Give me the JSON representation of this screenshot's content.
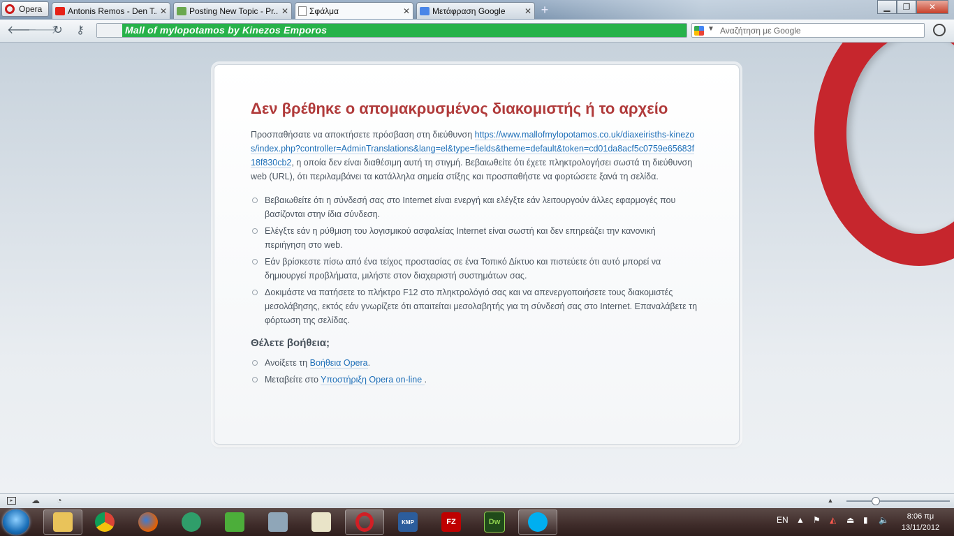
{
  "browser": {
    "menu_label": "Opera",
    "tabs": [
      {
        "title": "Antonis Remos - Den T...",
        "icon": "youtube-icon",
        "active": false
      },
      {
        "title": "Posting New Topic - Pr...",
        "icon": "forum-icon",
        "active": false
      },
      {
        "title": "Σφάλμα",
        "icon": "page-icon",
        "active": true
      },
      {
        "title": "Μετάφραση Google",
        "icon": "google-translate-icon",
        "active": false
      }
    ],
    "address": "Mall of mylopotamos by Kinezos Emporos",
    "search_placeholder": "Αναζήτηση με Google"
  },
  "error_page": {
    "title": "Δεν βρέθηκε ο απομακρυσμένος διακομιστής ή το αρχείο",
    "intro_before": "Προσπαθήσατε να αποκτήσετε πρόσβαση στη διεύθυνση ",
    "url": "https://www.mallofmylopotamos.co.uk/diaxeirisths-kinezos/index.php?controller=AdminTranslations&lang=el&type=fields&theme=default&token=cd01da8acf5c0759e65683f18f830cb2",
    "intro_after": ", η οποία δεν είναι διαθέσιμη αυτή τη στιγμή. Βεβαιωθείτε ότι έχετε πληκτρολογήσει σωστά τη διεύθυνση web (URL), ότι περιλαμβάνει τα κατάλληλα σημεία στίξης και προσπαθήστε να φορτώσετε ξανά τη σελίδα.",
    "tips": [
      "Βεβαιωθείτε ότι η σύνδεσή σας στο Internet είναι ενεργή και ελέγξτε εάν λειτουργούν άλλες εφαρμογές που βασίζονται στην ίδια σύνδεση.",
      "Ελέγξτε εάν η ρύθμιση του λογισμικού ασφαλείας Internet είναι σωστή και δεν επηρεάζει την κανονική περιήγηση στο web.",
      "Εάν βρίσκεστε πίσω από ένα τείχος προστασίας σε ένα Τοπικό Δίκτυο και πιστεύετε ότι αυτό μπορεί να δημιουργεί προβλήματα, μιλήστε στον διαχειριστή συστημάτων σας.",
      "Δοκιμάστε να πατήσετε το πλήκτρο F12 στο πληκτρολόγιό σας και να απενεργοποιήσετε τους διακομιστές μεσολάβησης, εκτός εάν γνωρίζετε ότι απαιτείται μεσολαβητής για τη σύνδεσή σας στο Internet. Επαναλάβετε τη φόρτωση της σελίδας."
    ],
    "help_heading": "Θέλετε βοήθεια;",
    "help1_before": "Ανοίξετε τη ",
    "help1_link": "Βοήθεια Opera",
    "help1_after": ".",
    "help2_before": "Μεταβείτε στο ",
    "help2_link": "Υποστήριξη Opera on-line ",
    "help2_after": "."
  },
  "taskbar": {
    "apps": [
      "explorer-icon",
      "chrome-icon",
      "firefox-icon",
      "glasses-icon",
      "shopping-bag-icon",
      "photo-icon",
      "chart-icon",
      "opera-icon",
      "kmplayer-icon",
      "filezilla-icon",
      "dreamweaver-icon",
      "skype-icon"
    ],
    "kmp_label": "KMP",
    "fz_label": "FZ",
    "dw_label": "Dw",
    "language": "EN",
    "time": "8:06 πμ",
    "date": "13/11/2012"
  },
  "colors": {
    "title_red": "#b03a3a",
    "link_blue": "#1e6fb8",
    "address_green": "#27b24a"
  }
}
